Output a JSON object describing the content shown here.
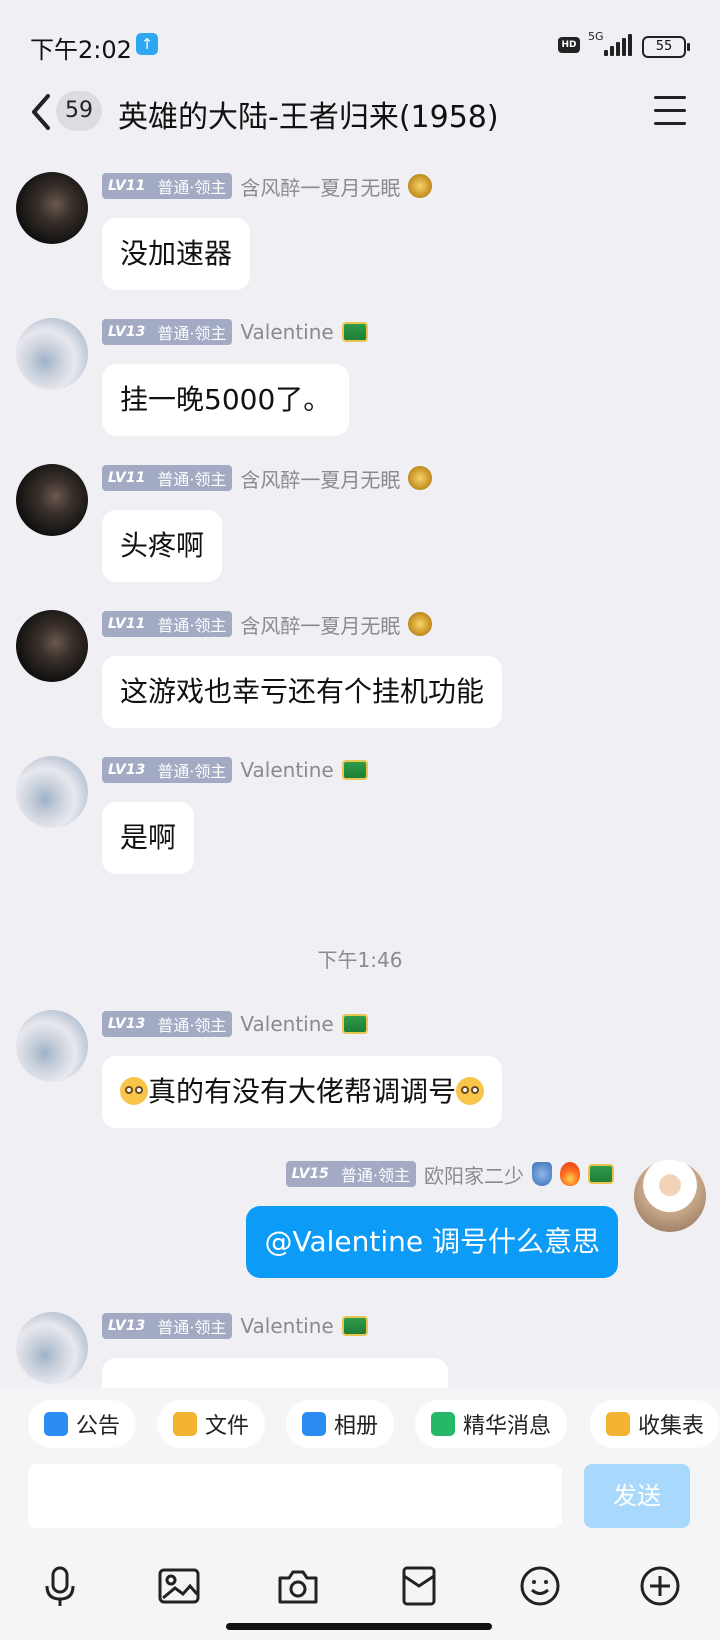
{
  "status_bar": {
    "time": "下午2:02",
    "network": "5G",
    "battery": "55"
  },
  "header": {
    "unread_count": "59",
    "title": "英雄的大陆-王者归来(1958)"
  },
  "messages": [
    {
      "level": "LV11",
      "role": "普通·领主",
      "sender": "含风醉一夏月无眠",
      "text": "没加速器"
    },
    {
      "level": "LV13",
      "role": "普通·领主",
      "sender": "Valentine",
      "text": "挂一晚5000了。"
    },
    {
      "level": "LV11",
      "role": "普通·领主",
      "sender": "含风醉一夏月无眠",
      "text": "头疼啊"
    },
    {
      "level": "LV11",
      "role": "普通·领主",
      "sender": "含风醉一夏月无眠",
      "text": "这游戏也幸亏还有个挂机功能"
    },
    {
      "level": "LV13",
      "role": "普通·领主",
      "sender": "Valentine",
      "text": "是啊"
    },
    {
      "level": "LV13",
      "role": "普通·领主",
      "sender": "Valentine",
      "text": "真的有没有大佬帮调调号"
    },
    {
      "level": "LV15",
      "role": "普通·领主",
      "sender": "欧阳家二少",
      "text": "@Valentine 调号什么意思"
    },
    {
      "level": "LV13",
      "role": "普通·领主",
      "sender": "Valentine",
      "text": ""
    }
  ],
  "timestamp": "下午1:46",
  "quick_actions": [
    "公告",
    "文件",
    "相册",
    "精华消息",
    "收集表"
  ],
  "send_label": "发送",
  "icons": [
    "microphone-icon",
    "image-icon",
    "camera-icon",
    "red-packet-icon",
    "emoji-icon",
    "plus-icon"
  ],
  "colors": {
    "accent": "#0d9bf8",
    "level_badge": "#a3abc4",
    "background": "#efeff4"
  }
}
